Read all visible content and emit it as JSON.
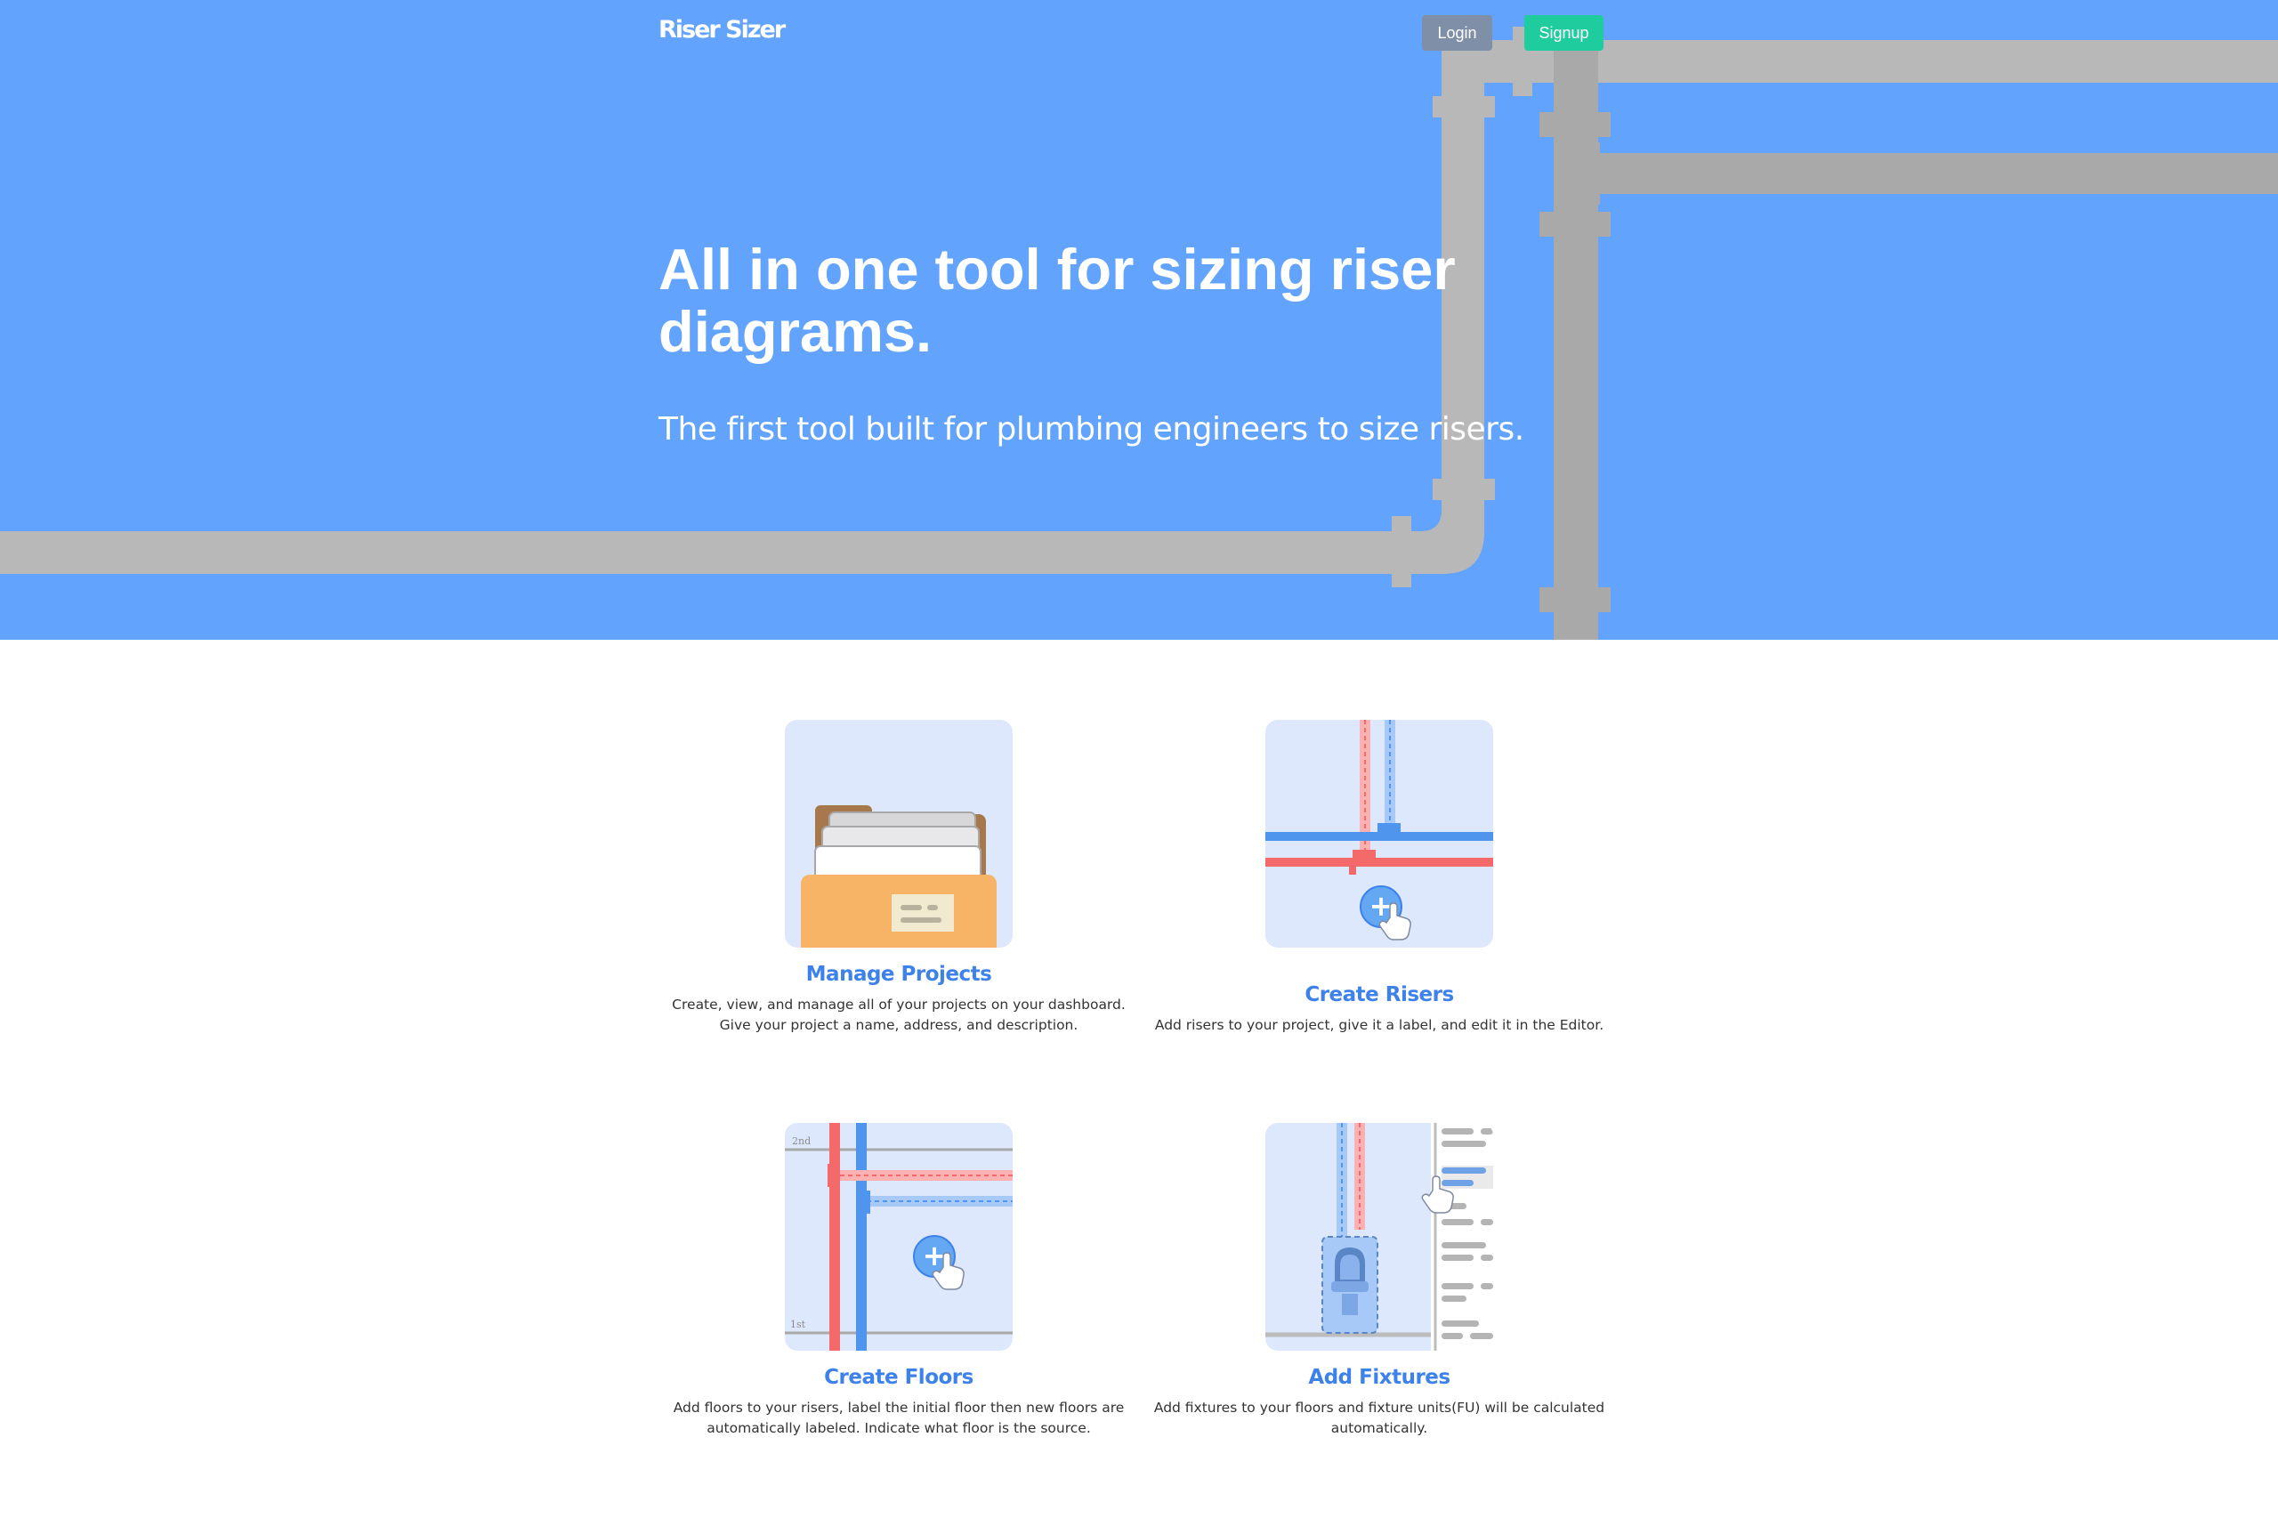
{
  "header": {
    "logo": "Riser Sizer",
    "login_label": "Login",
    "signup_label": "Signup"
  },
  "hero": {
    "title": "All in one tool for sizing riser diagrams.",
    "subtitle": "The first tool built for plumbing engineers to size risers."
  },
  "features": [
    {
      "title": "Manage Projects",
      "description": "Create, view, and manage all of your projects on your dashboard. Give your project a name, address, and description."
    },
    {
      "title": "Create Risers",
      "description": "Add risers to your project, give it a label, and edit it in the Editor."
    },
    {
      "title": "Create Floors",
      "description": "Add floors to your risers, label the initial floor then new floors are automatically labeled. Indicate what floor is the source."
    },
    {
      "title": "Add Fixtures",
      "description": "Add fixtures to your floors and fixture units(FU) will be calculated automatically."
    }
  ],
  "illustrations": {
    "floor_labels": [
      "2nd",
      "1st"
    ]
  },
  "colors": {
    "hero_bg": "#62a3fd",
    "pipe": "#b8b8b8",
    "login_bg": "#7e8fa7",
    "signup_bg": "#1fcc9d",
    "feature_title": "#3d82ea",
    "card_bg": "#dde8fd"
  }
}
